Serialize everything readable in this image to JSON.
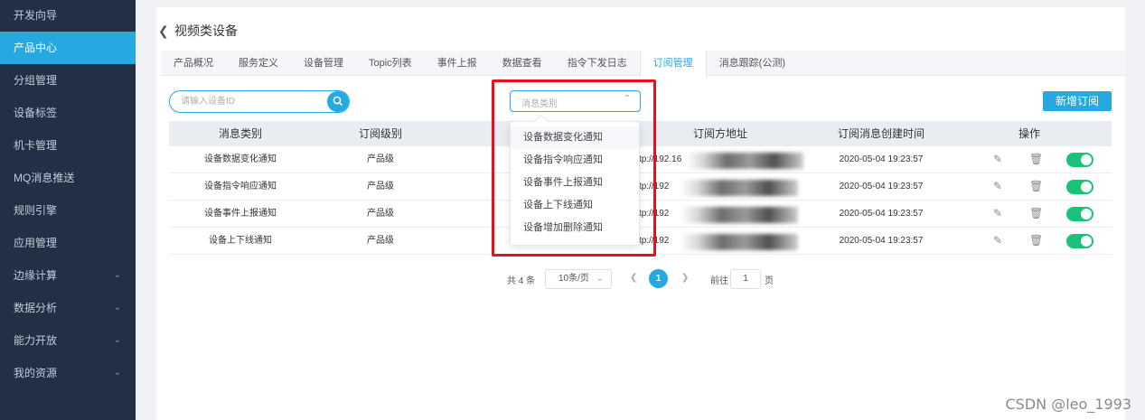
{
  "sidebar": {
    "items": [
      {
        "label": "开发向导",
        "has_children": false
      },
      {
        "label": "产品中心",
        "has_children": false,
        "active": true
      },
      {
        "label": "分组管理",
        "has_children": false
      },
      {
        "label": "设备标签",
        "has_children": false
      },
      {
        "label": "机卡管理",
        "has_children": false
      },
      {
        "label": "MQ消息推送",
        "has_children": false
      },
      {
        "label": "规则引擎",
        "has_children": false
      },
      {
        "label": "应用管理",
        "has_children": false
      },
      {
        "label": "边缘计算",
        "has_children": true
      },
      {
        "label": "数据分析",
        "has_children": true
      },
      {
        "label": "能力开放",
        "has_children": true
      },
      {
        "label": "我的资源",
        "has_children": true
      }
    ]
  },
  "header": {
    "title": "视频类设备"
  },
  "tabs": [
    {
      "label": "产品概况"
    },
    {
      "label": "服务定义"
    },
    {
      "label": "设备管理"
    },
    {
      "label": "Topic列表"
    },
    {
      "label": "事件上报"
    },
    {
      "label": "数据查看"
    },
    {
      "label": "指令下发日志"
    },
    {
      "label": "订阅管理",
      "active": true
    },
    {
      "label": "消息跟踪(公测)"
    }
  ],
  "search": {
    "placeholder": "请输入设备ID"
  },
  "filter": {
    "placeholder": "消息类别"
  },
  "add_button": {
    "label": "新增订阅"
  },
  "table": {
    "columns": [
      "消息类别",
      "订阅级别",
      "订阅方地址",
      "订阅消息创建时间",
      "操作"
    ],
    "rows": [
      {
        "type": "设备数据变化通知",
        "level": "产品级",
        "address": "tp://192.16",
        "created": "2020-05-04 19:23:57",
        "enabled": true
      },
      {
        "type": "设备指令响应通知",
        "level": "产品级",
        "address": "tp://192",
        "created": "2020-05-04 19:23:57",
        "enabled": true
      },
      {
        "type": "设备事件上报通知",
        "level": "产品级",
        "address": "tp://192",
        "created": "2020-05-04 19:23:57",
        "enabled": true
      },
      {
        "type": "设备上下线通知",
        "level": "产品级",
        "address": "tp://192",
        "created": "2020-05-04 19:23:57",
        "enabled": true
      }
    ]
  },
  "dropdown": {
    "options": [
      "设备数据变化通知",
      "设备指令响应通知",
      "设备事件上报通知",
      "设备上下线通知",
      "设备增加删除通知"
    ]
  },
  "pagination": {
    "total_text": "共 4 条",
    "page_size": "10条/页",
    "current_page": "1",
    "goto_label": "前往",
    "goto_value": "1",
    "unit": "页"
  },
  "icons": {
    "back": "chevron-left-icon",
    "search": "search-icon",
    "edit": "edit-icon",
    "delete": "trash-icon",
    "toggle": "toggle-switch"
  },
  "colors": {
    "sidebar_bg": "#223046",
    "accent": "#25a9e0",
    "toggle_on": "#19c276",
    "highlight": "#e8101a"
  },
  "watermark": "CSDN @leo_1993"
}
